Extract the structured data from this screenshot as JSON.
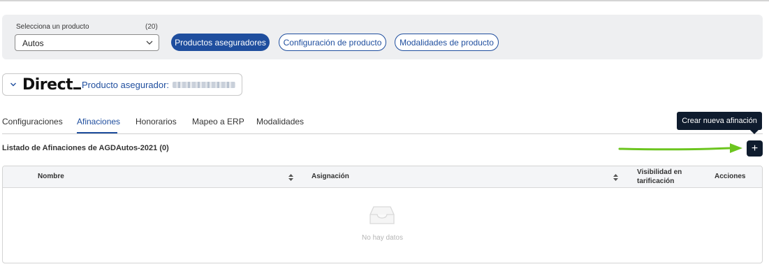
{
  "filter": {
    "product_label": "Selecciona un producto",
    "product_count": "(20)",
    "product_value": "Autos"
  },
  "nav_pills": {
    "insurer_products": "Productos aseguradores",
    "product_config": "Configuración de producto",
    "product_modalities": "Modalidades de producto"
  },
  "insurer": {
    "logo_text": "Direct",
    "label": "Producto asegurador:"
  },
  "tabs": [
    "Configuraciones",
    "Afinaciones",
    "Honorarios",
    "Mapeo a ERP",
    "Modalidades"
  ],
  "active_tab": "Afinaciones",
  "list": {
    "title": "Listado de Afinaciones de AGDAutos-2021 (0)",
    "add_tooltip": "Crear nueva afinación",
    "add_symbol": "+"
  },
  "table": {
    "columns": [
      "Nombre",
      "Asignación",
      "Visibilidad en tarificación",
      "Acciones"
    ],
    "empty_text": "No hay datos"
  },
  "colors": {
    "brand": "#1f4e9e",
    "dark": "#0f1c2e",
    "annotation_arrow": "#6cc51f"
  }
}
